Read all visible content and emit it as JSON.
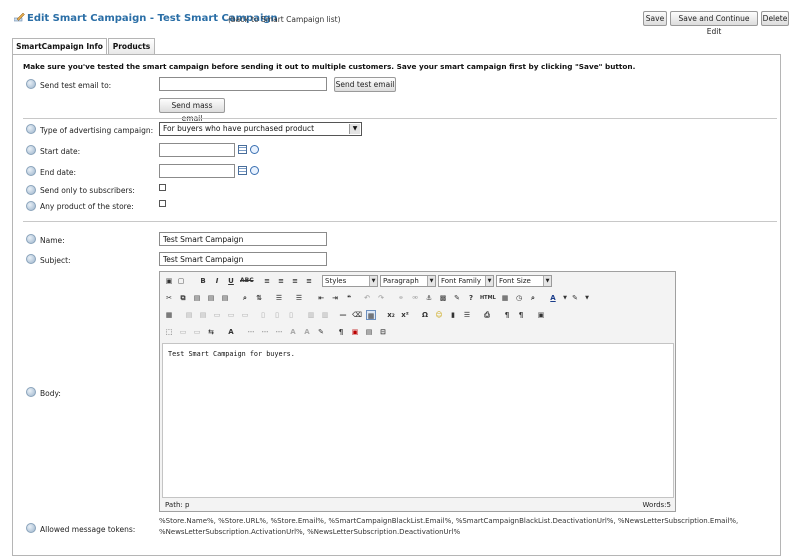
{
  "header": {
    "title": "Edit Smart Campaign - Test Smart Campaign",
    "back_link": "(back to Smart Campaign list)",
    "buttons": {
      "save": "Save",
      "save_continue": "Save and Continue Edit",
      "delete": "Delete"
    }
  },
  "tabs": [
    {
      "label": "SmartCampaign Info",
      "active": true
    },
    {
      "label": "Products",
      "active": false
    }
  ],
  "info_text": "Make sure you've tested the smart campaign before sending it out to multiple customers. Save your smart campaign first by clicking \"Save\" button.",
  "test_email": {
    "label": "Send test email to:",
    "value": "",
    "send_test_button": "Send test email",
    "send_mass_button": "Send mass email"
  },
  "campaign_type": {
    "label": "Type of advertising campaign:",
    "selected": "For buyers who have purchased product"
  },
  "start_date": {
    "label": "Start date:",
    "value": ""
  },
  "end_date": {
    "label": "End date:",
    "value": ""
  },
  "subscribers_only": {
    "label": "Send only to subscribers:",
    "checked": false
  },
  "any_product": {
    "label": "Any product of the store:",
    "checked": false
  },
  "name": {
    "label": "Name:",
    "value": "Test Smart Campaign"
  },
  "subject": {
    "label": "Subject:",
    "value": "Test Smart Campaign"
  },
  "body": {
    "label": "Body:",
    "toolbar": {
      "styles": "Styles",
      "format": "Paragraph",
      "font_family": "Font Family",
      "font_size": "Font Size"
    },
    "content": "Test Smart Campaign for buyers.",
    "path": "Path: p",
    "words": "Words:5"
  },
  "tokens": {
    "label": "Allowed message tokens:",
    "value": "%Store.Name%, %Store.URL%, %Store.Email%, %SmartCampaignBlackList.Email%, %SmartCampaignBlackList.DeactivationUrl%, %NewsLetterSubscription.Email%, %NewsLetterSubscription.ActivationUrl%, %NewsLetterSubscription.DeactivationUrl%"
  },
  "colors": {
    "title": "#2a6ea6",
    "border": "#b5b5b5"
  }
}
